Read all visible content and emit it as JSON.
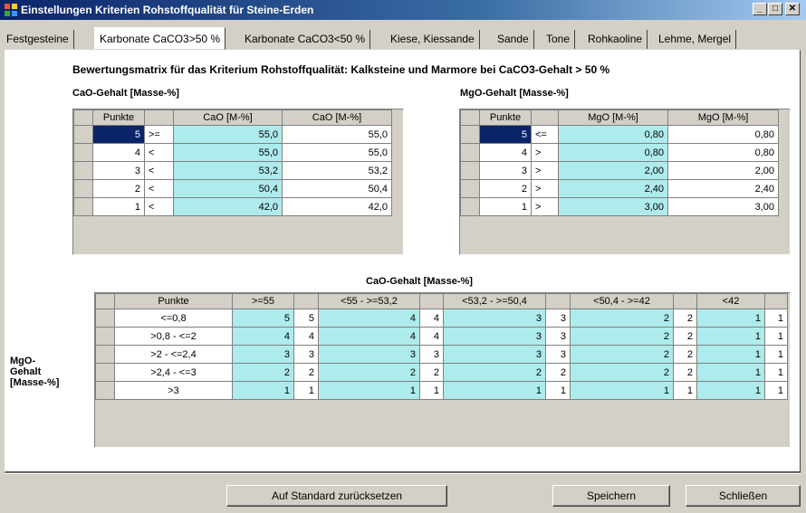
{
  "window": {
    "title": "Einstellungen Kriterien Rohstoffqualität für Steine-Erden",
    "minimize": "_",
    "maximize": "□",
    "close": "✕"
  },
  "tabs": [
    {
      "label": "Festgesteine"
    },
    {
      "label": "Karbonate CaCO3>50 %"
    },
    {
      "label": "Karbonate CaCO3<50 %"
    },
    {
      "label": "Kiese, Kiessande"
    },
    {
      "label": "Sande"
    },
    {
      "label": "Tone"
    },
    {
      "label": "Rohkaoline"
    },
    {
      "label": "Lehme, Mergel"
    }
  ],
  "heading": "Bewertungsmatrix für das Kriterium Rohstoffqualität: Kalksteine und Marmore bei CaCO3-Gehalt > 50 %",
  "cao": {
    "label": "CaO-Gehalt [Masse-%]",
    "headers": [
      "Punkte",
      "",
      "CaO [M-%]",
      "CaO [M-%]"
    ],
    "rows": [
      {
        "punkte": "5",
        "op": ">=",
        "v1": "55,0",
        "v2": "55,0"
      },
      {
        "punkte": "4",
        "op": "<",
        "v1": "55,0",
        "v2": "55,0"
      },
      {
        "punkte": "3",
        "op": "<",
        "v1": "53,2",
        "v2": "53,2"
      },
      {
        "punkte": "2",
        "op": "<",
        "v1": "50,4",
        "v2": "50,4"
      },
      {
        "punkte": "1",
        "op": "<",
        "v1": "42,0",
        "v2": "42,0"
      }
    ]
  },
  "mgo": {
    "label": "MgO-Gehalt [Masse-%]",
    "headers": [
      "Punkte",
      "",
      "MgO [M-%]",
      "MgO [M-%]"
    ],
    "rows": [
      {
        "punkte": "5",
        "op": "<=",
        "v1": "0,80",
        "v2": "0,80"
      },
      {
        "punkte": "4",
        "op": ">",
        "v1": "0,80",
        "v2": "0,80"
      },
      {
        "punkte": "3",
        "op": ">",
        "v1": "2,00",
        "v2": "2,00"
      },
      {
        "punkte": "2",
        "op": ">",
        "v1": "2,40",
        "v2": "2,40"
      },
      {
        "punkte": "1",
        "op": ">",
        "v1": "3,00",
        "v2": "3,00"
      }
    ]
  },
  "matrix": {
    "label": "CaO-Gehalt [Masse-%]",
    "side_label": [
      "MgO-",
      "Gehalt",
      "[Masse-%]"
    ],
    "headers": [
      "Punkte",
      ">=55",
      "",
      "<55 - >=53,2",
      "",
      "<53,2 - >=50,4",
      "",
      "<50,4 - >=42",
      "",
      "<42",
      ""
    ],
    "rows": [
      {
        "label": "<=0,8",
        "cells": [
          "5",
          "5",
          "4",
          "4",
          "3",
          "3",
          "2",
          "2",
          "1",
          "1"
        ]
      },
      {
        "label": ">0,8 - <=2",
        "cells": [
          "4",
          "4",
          "4",
          "4",
          "3",
          "3",
          "2",
          "2",
          "1",
          "1"
        ]
      },
      {
        "label": ">2 - <=2,4",
        "cells": [
          "3",
          "3",
          "3",
          "3",
          "3",
          "3",
          "2",
          "2",
          "1",
          "1"
        ]
      },
      {
        "label": ">2,4 - <=3",
        "cells": [
          "2",
          "2",
          "2",
          "2",
          "2",
          "2",
          "2",
          "2",
          "1",
          "1"
        ]
      },
      {
        "label": ">3",
        "cells": [
          "1",
          "1",
          "1",
          "1",
          "1",
          "1",
          "1",
          "1",
          "1",
          "1"
        ]
      }
    ]
  },
  "buttons": {
    "reset": "Auf Standard zurücksetzen",
    "save": "Speichern",
    "close": "Schließen"
  },
  "colors": {
    "cell_accent": "#aeebec",
    "selection": "#0a246a",
    "title_bar": "#0a246a"
  }
}
